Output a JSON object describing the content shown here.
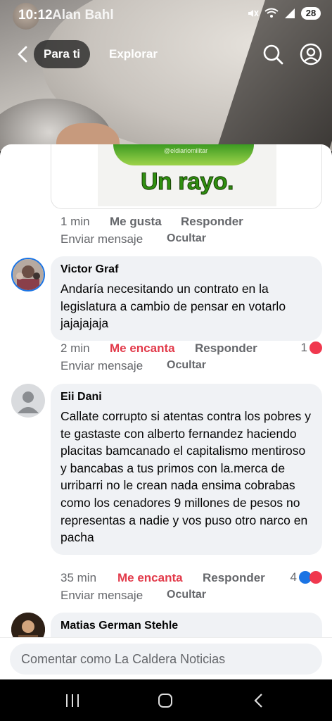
{
  "status_bar": {
    "time": "10:12",
    "name": "Alan Bahl",
    "battery": "28"
  },
  "top_nav": {
    "tab_active": "Para ti",
    "tab_explore": "Explorar"
  },
  "sticker": {
    "watermark": "@eldiariomilitar",
    "text": "Un rayo."
  },
  "first_comment_actions": {
    "time": "1 min",
    "like": "Me gusta",
    "reply": "Responder",
    "message": "Enviar mensaje",
    "hide": "Ocultar"
  },
  "comments": [
    {
      "author": "Victor Graf",
      "text": "Andaría necesitando un contrato en la legislatura a cambio de pensar en votarlo jajajajaja",
      "time": "2 min",
      "reaction_label": "Me encanta",
      "reply": "Responder",
      "reaction_count": "1",
      "message": "Enviar mensaje",
      "hide": "Ocultar"
    },
    {
      "author": "Eii Dani",
      "text": "Callate corrupto si atentas contra los pobres y te gastaste con alberto fernandez haciendo placitas bamcanado el capitalismo mentiroso y bancabas a tus primos con la.merca de urribarri no le crean nada ensima cobrabas como los cenadores 9 millones de pesos no representas a nadie y vos puso otro narco en pacha",
      "time": "35 min",
      "reaction_label": "Me encanta",
      "reply": "Responder",
      "reaction_count": "4",
      "message": "Enviar mensaje",
      "hide": "Ocultar"
    },
    {
      "author": "Matias German Stehle"
    }
  ],
  "composer": {
    "placeholder": "Comentar como La Caldera Noticias"
  },
  "colors": {
    "love": "#e23a4a",
    "bubble": "#f0f2f5",
    "secondary_text": "#65676b",
    "like_blue": "#1b74e4"
  },
  "icons": [
    "back-arrow-icon",
    "search-icon",
    "profile-icon",
    "refresh-icon",
    "heart-icon",
    "like-icon",
    "recents-icon",
    "home-icon",
    "back-nav-icon"
  ]
}
